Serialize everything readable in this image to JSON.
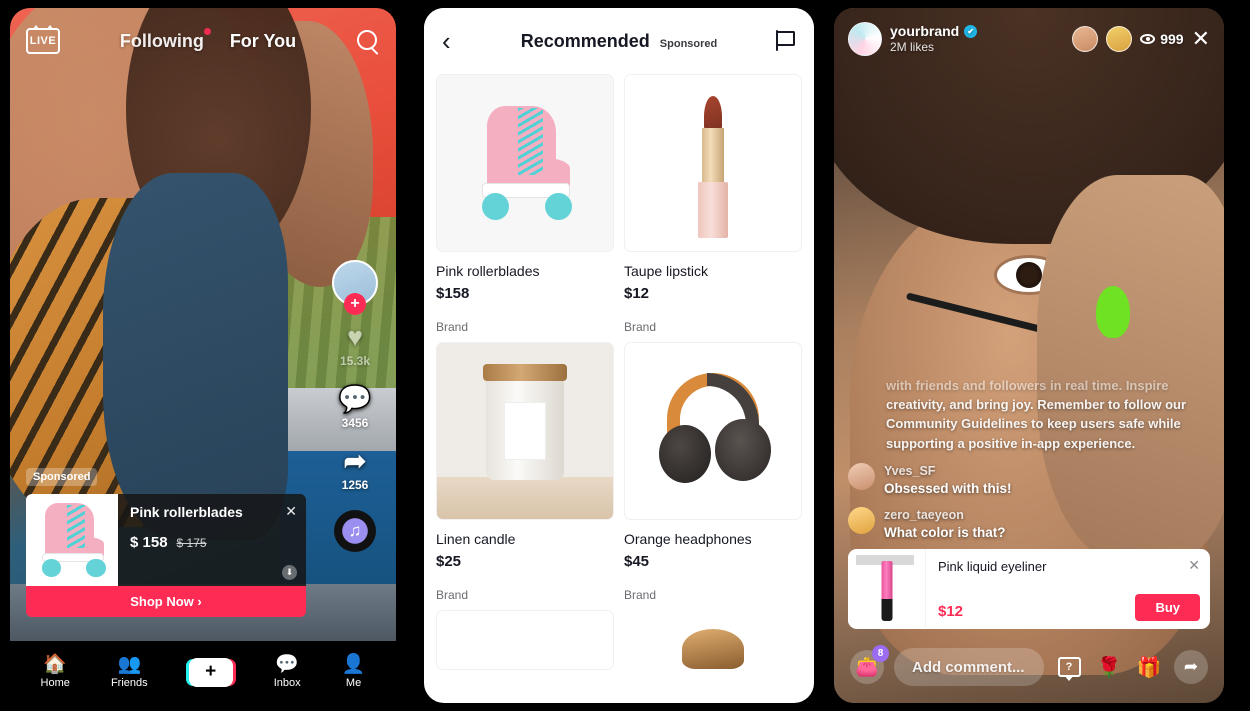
{
  "feed": {
    "live_badge": "LIVE",
    "tabs": [
      {
        "label": "Following",
        "active": false
      },
      {
        "label": "For You",
        "active": true
      }
    ],
    "search_icon": "search-icon",
    "rail": {
      "follow_plus": "+",
      "like_count": "15.3k",
      "comment_count": "3456",
      "share_count": "1256"
    },
    "sponsored_label": "Sponsored",
    "ad": {
      "title": "Pink rollerblades",
      "price": "$ 158",
      "original_price": "$ 175",
      "cta": "Shop Now  ›",
      "close": "✕"
    },
    "nav": [
      {
        "label": "Home",
        "icon": "home-icon"
      },
      {
        "label": "Friends",
        "icon": "friends-icon"
      },
      {
        "label": "",
        "icon": "create-icon"
      },
      {
        "label": "Inbox",
        "icon": "inbox-icon"
      },
      {
        "label": "Me",
        "icon": "profile-icon"
      }
    ],
    "create_label": "+"
  },
  "shop": {
    "back": "‹",
    "title": "Recommended",
    "subtitle": "Sponsored",
    "flag_icon": "flag-icon",
    "products": [
      {
        "name": "Pink rollerblades",
        "price": "$158",
        "brand": "Brand",
        "image": "roller-skate-image"
      },
      {
        "name": "Taupe lipstick",
        "price": "$12",
        "brand": "Brand",
        "image": "lipstick-image"
      },
      {
        "name": "Linen candle",
        "price": "$25",
        "brand": "Brand",
        "image": "candle-image"
      },
      {
        "name": "Orange headphones",
        "price": "$45",
        "brand": "Brand",
        "image": "headphones-image"
      }
    ]
  },
  "live": {
    "username": "yourbrand",
    "verified": "✔",
    "likes": "2M likes",
    "viewer_count": "999",
    "close": "✕",
    "system_message_dim": "with friends and followers in real time. Inspire",
    "system_message": "creativity, and bring joy. Remember to follow our Community Guidelines to keep users safe while supporting a positive in-app experience.",
    "comments": [
      {
        "user": "Yves_SF",
        "text": "Obsessed with this!"
      },
      {
        "user": "zero_taeyeon",
        "text": "What color is that?"
      }
    ],
    "product": {
      "title": "Pink liquid eyeliner",
      "price": "$12",
      "buy_label": "Buy",
      "close": "✕"
    },
    "bottom_bar": {
      "bag_badge": "8",
      "comment_placeholder": "Add comment...",
      "qa_label": "?",
      "rose_icon": "🌹",
      "gift_icon": "🎁",
      "share_icon": "➦"
    }
  },
  "colors": {
    "accent_pink": "#fe2c55",
    "cyan": "#25f4ee",
    "verified_blue": "#20b7e8",
    "badge_purple": "#9b6bf2"
  }
}
